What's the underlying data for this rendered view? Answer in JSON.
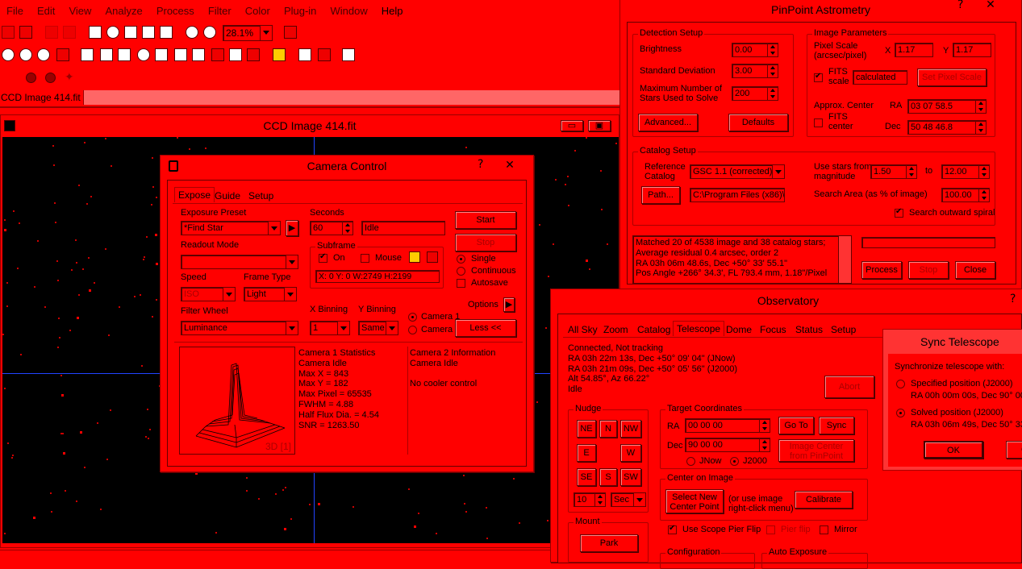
{
  "menu": [
    "File",
    "Edit",
    "View",
    "Analyze",
    "Process",
    "Filter",
    "Color",
    "Plug-in",
    "Window",
    "Help"
  ],
  "toolbar": {
    "zoom": "28.1%"
  },
  "doc_tab": "CCD Image 414.fit",
  "image_window": {
    "title": "CCD Image 414.fit"
  },
  "camera": {
    "title": "Camera Control",
    "help": "?",
    "tabs": [
      "Expose",
      "Guide",
      "Setup"
    ],
    "exposure_preset_label": "Exposure Preset",
    "exposure_preset": "*Find Star",
    "seconds_label": "Seconds",
    "seconds": "60",
    "status": "Idle",
    "start": "Start",
    "stop": "Stop",
    "readout_label": "Readout Mode",
    "subframe_label": "Subframe",
    "on_label": "On",
    "mouse_label": "Mouse",
    "subframe_coords": "X:   0 Y:   0 W:2749 H:2199",
    "single": "Single",
    "continuous": "Continuous",
    "autosave": "Autosave",
    "speed_label": "Speed",
    "speed": "ISO",
    "frame_type_label": "Frame Type",
    "frame_type": "Light",
    "options": "Options",
    "less": "Less <<",
    "filter_label": "Filter Wheel",
    "filter": "Luminance",
    "xbin_label": "X Binning",
    "xbin": "1",
    "ybin_label": "Y Binning",
    "ybin": "Same",
    "camera1": "Camera 1",
    "camera2": "Camera 2",
    "plot_label": "3D [1]",
    "stats": [
      "Camera 1 Statistics",
      "Camera Idle",
      "Max X = 843",
      "Max Y = 182",
      "Max Pixel = 65535",
      "FWHM = 4.88",
      "Half Flux Dia. = 4.54",
      "SNR = 1263.50"
    ],
    "info": [
      "Camera 2 Information",
      "Camera Idle",
      "",
      "No cooler control"
    ]
  },
  "pinpoint": {
    "title": "PinPoint Astrometry",
    "help": "?",
    "detection": "Detection Setup",
    "brightness_label": "Brightness",
    "brightness": "0.00",
    "stddev_label": "Standard Deviation",
    "stddev": "3.00",
    "maxstars_label1": "Maximum Number of",
    "maxstars_label2": "Stars Used to Solve",
    "maxstars": "200",
    "advanced": "Advanced...",
    "defaults": "Defaults",
    "image_params": "Image Parameters",
    "pixel_scale_label1": "Pixel Scale",
    "pixel_scale_label2": "(arcsec/pixel)",
    "x_label": "X",
    "x_val": "1.17",
    "y_label": "Y",
    "y_val": "1.17",
    "fits_scale1": "FITS",
    "fits_scale2": "scale",
    "calculated": "calculated",
    "set_pixel_scale": "Set Pixel Scale",
    "approx_center": "Approx. Center",
    "ra_label": "RA",
    "ra": "03 07 58.5",
    "fits_center1": "FITS",
    "fits_center2": "center",
    "dec_label": "Dec",
    "dec": "50 48 46.8",
    "catalog_setup": "Catalog Setup",
    "ref_cat1": "Reference",
    "ref_cat2": "Catalog",
    "ref_cat": "GSC 1.1 (corrected)",
    "use_stars1": "Use stars from",
    "use_stars2": "magnitude",
    "mag_from": "1.50",
    "to": "to",
    "mag_to": "12.00",
    "path": "Path...",
    "path_val": "C:\\Program Files (x86)\\C",
    "search_area_label": "Search Area (as % of image)",
    "search_area": "100.00",
    "search_outward": "Search outward spiral",
    "results": [
      "Matched 20 of 4538 image and 38 catalog stars;",
      "Average residual 0.4 arcsec, order 2",
      "RA 03h 06m 48.6s,  Dec +50° 33' 55.1\"",
      "Pos Angle +266° 34.3', FL 793.4 mm, 1.18\"/Pixel"
    ],
    "process": "Process",
    "stop": "Stop",
    "close": "Close"
  },
  "observatory": {
    "title": "Observatory",
    "help": "?",
    "tabs": [
      "All Sky",
      "Zoom",
      "Catalog",
      "Telescope",
      "Dome",
      "Focus",
      "Status",
      "Setup"
    ],
    "status": [
      "Connected, Not tracking",
      "RA 03h 22m 13s, Dec +50° 09' 04\" (JNow)",
      "RA 03h 21m 09s, Dec +50° 05' 56\" (J2000)",
      "Alt 54.85°, Az 66.22°",
      "Idle"
    ],
    "abort": "Abort",
    "nudge": "Nudge",
    "ne": "NE",
    "n": "N",
    "nw": "NW",
    "e": "E",
    "w": "W",
    "se": "SE",
    "s": "S",
    "sw": "SW",
    "nudge_val": "10",
    "nudge_unit": "Sec",
    "target": "Target Coordinates",
    "ra_label": "RA",
    "ra": "00 00 00",
    "dec_label": "Dec",
    "dec": "90 00 00",
    "jnow": "JNow",
    "j2000": "J2000",
    "goto": "Go To",
    "sync": "Sync",
    "image_center1": "Image Center",
    "image_center2": "from PinPoint",
    "center_on_image": "Center on Image",
    "select_center1": "Select New",
    "select_center2": "Center Point",
    "or_use1": "(or use image",
    "or_use2": "right-click menu)",
    "calibrate": "Calibrate",
    "use_pier_flip": "Use Scope Pier Flip",
    "pier_flip": "Pier flip",
    "mirror": "Mirror",
    "mount": "Mount",
    "park": "Park",
    "configuration": "Configuration",
    "auto_exposure": "Auto Exposure"
  },
  "sync": {
    "title": "Sync Telescope",
    "with": "Synchronize telescope with:",
    "specified": "Specified position (J2000)",
    "specified_val": "RA 00h 00m 00s, Dec 90° 00",
    "solved": "Solved position (J2000)",
    "solved_val": "RA 03h 06m 49s, Dec 50° 33",
    "ok": "OK",
    "cancel": "C"
  }
}
